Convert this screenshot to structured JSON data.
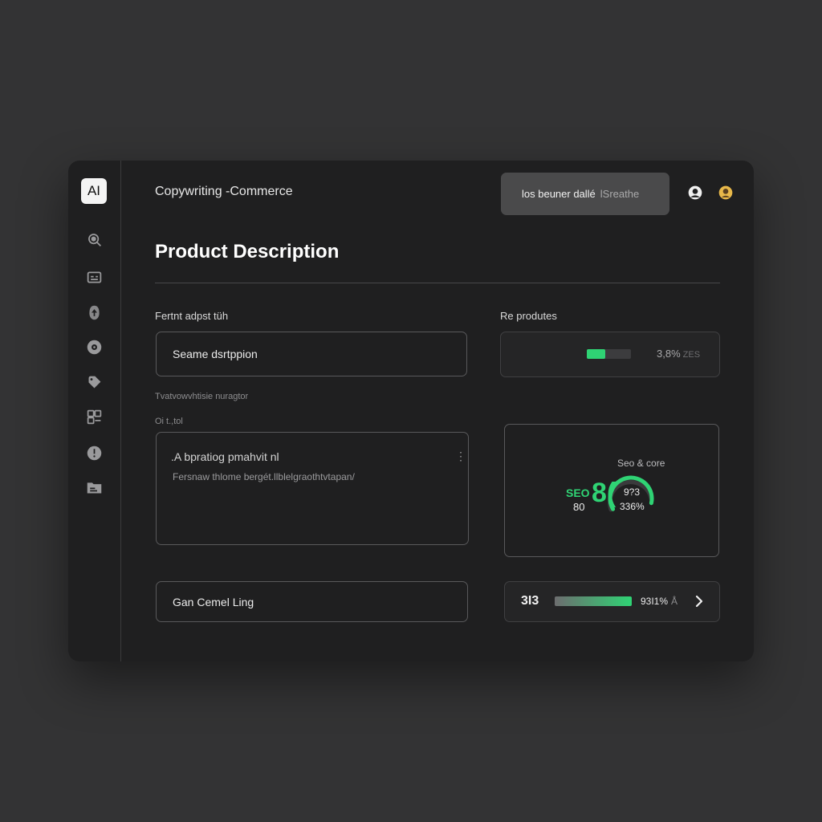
{
  "app": {
    "logo_text": "AI",
    "title": "Copywriting -Commerce"
  },
  "search": {
    "value": "los beuner dallé",
    "placeholder": "lSreathe"
  },
  "topbar": {
    "icons": [
      "profile-icon",
      "avatar-icon"
    ],
    "avatar_color": "#e8b84a"
  },
  "sidebar": {
    "items": [
      {
        "icon": "search-icon"
      },
      {
        "icon": "card-icon"
      },
      {
        "icon": "upload-icon"
      },
      {
        "icon": "disc-icon"
      },
      {
        "icon": "tag-icon"
      },
      {
        "icon": "layout-icon"
      },
      {
        "icon": "info-icon"
      },
      {
        "icon": "folder-icon"
      }
    ]
  },
  "page": {
    "title": "Product Description"
  },
  "form": {
    "input_label": "Fertnt adpst tüh",
    "input_value": "Seame dsrtppion",
    "helper_label": "Tvatvowvhtisie nuragtor",
    "output_label": "Oi t.,tol",
    "output_line1": ".A bpratiog pmahvit nl",
    "output_line2": "Fersnaw thlome bergét.llblelgraothtvtapan/",
    "generate_label": "Gan Cemel Ling"
  },
  "side_panels": {
    "products_label": "Re produtes",
    "products_pct": "3,8%",
    "products_pct_suffix": "ZES",
    "products_progress": 0.42,
    "seo_title": "Seo & core",
    "seo_label": "SEO",
    "seo_value": "80",
    "seo_letters": "8(",
    "seo_pct1": "9?3",
    "seo_pct2": "336%",
    "seo_gauge_level": 0.8,
    "bottom_number": "3I3",
    "bottom_pct": "93I1%",
    "bottom_pct_suffix": "Å",
    "bottom_progress": 1.0
  },
  "colors": {
    "accent": "#2fd374",
    "background": "#333334",
    "window": "#1f1f20"
  }
}
